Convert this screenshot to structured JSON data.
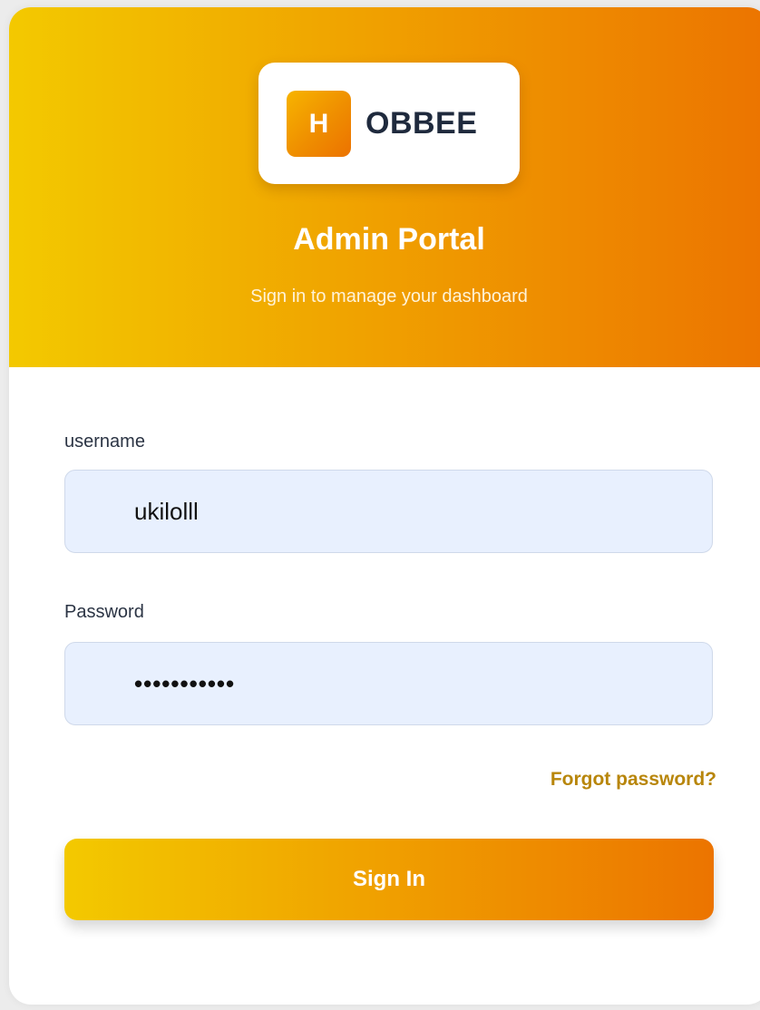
{
  "brand": {
    "logo_letter": "H",
    "logo_text": "OBBEE"
  },
  "header": {
    "title": "Admin Portal",
    "subtitle": "Sign in to manage your dashboard"
  },
  "form": {
    "username_label": "username",
    "username_value": "ukilolll",
    "password_label": "Password",
    "password_value": "•••••••••••",
    "forgot_link": "Forgot password?",
    "submit_label": "Sign In"
  },
  "colors": {
    "gradient_start": "#f3c900",
    "gradient_mid": "#f0a300",
    "gradient_end": "#ec7400",
    "input_background": "#e8f0fe",
    "link": "#b8860b"
  }
}
